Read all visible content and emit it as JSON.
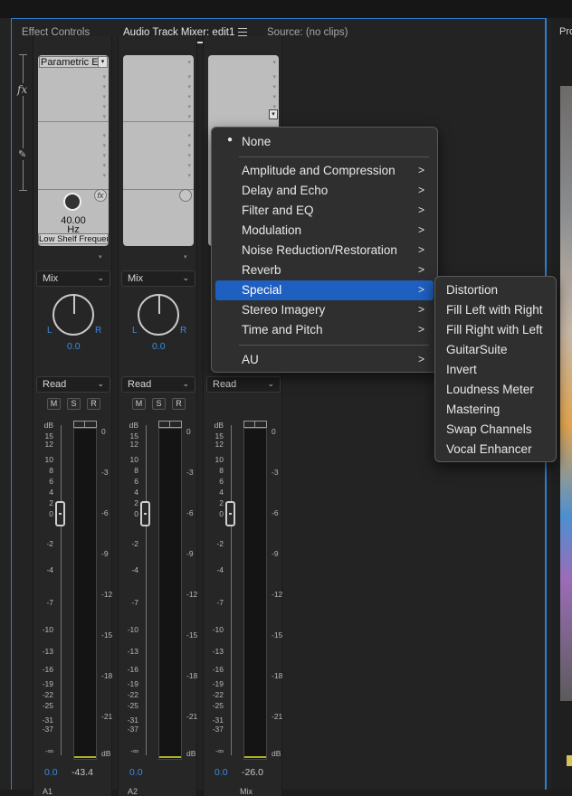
{
  "tabs": [
    {
      "label": "Effect Controls"
    },
    {
      "label": "Audio Track Mixer: edit1"
    },
    {
      "label": "Source: (no clips)"
    }
  ],
  "right_panel_tab": "Pro",
  "side_icons": [
    "fx-icon",
    "pen-icon"
  ],
  "channels": [
    {
      "effect_slot": "Parametric Eq",
      "param_value": "40.00",
      "param_unit": "Hz",
      "param_select": "Low Shelf Frequency",
      "mode": "Mix",
      "pan_value": "0.0",
      "automation": "Read",
      "msr": [
        "M",
        "S",
        "R"
      ],
      "fader_value": "0.0",
      "peak_value": "-43.4",
      "footer_label": "A1"
    },
    {
      "effect_slot": "",
      "mode": "Mix",
      "pan_value": "0.0",
      "automation": "Read",
      "msr": [
        "M",
        "S",
        "R"
      ],
      "fader_value": "0.0",
      "peak_value": "",
      "footer_label": "A2"
    },
    {
      "effect_slot": "",
      "automation": "Read",
      "fader_value": "0.0",
      "peak_value": "-26.0",
      "footer_label": "Mix"
    }
  ],
  "pan_labels": {
    "left": "L",
    "right": "R"
  },
  "fader_scale": [
    "dB",
    "15",
    "12",
    "10",
    "8",
    "6",
    "4",
    "2",
    "0",
    "-2",
    "-4",
    "-7",
    "-10",
    "-13",
    "-16",
    "-19",
    "-22",
    "-25",
    "-31",
    "-37",
    "-∞"
  ],
  "meter_scale": [
    "0",
    "-3",
    "-6",
    "-9",
    "-12",
    "-15",
    "-18",
    "-21",
    "dB"
  ],
  "context_menu": {
    "items": [
      {
        "label": "None",
        "bullet": true
      },
      {
        "label": "Amplitude and Compression",
        "submenu": true
      },
      {
        "label": "Delay and Echo",
        "submenu": true
      },
      {
        "label": "Filter and EQ",
        "submenu": true
      },
      {
        "label": "Modulation",
        "submenu": true
      },
      {
        "label": "Noise Reduction/Restoration",
        "submenu": true
      },
      {
        "label": "Reverb",
        "submenu": true
      },
      {
        "label": "Special",
        "submenu": true,
        "selected": true
      },
      {
        "label": "Stereo Imagery",
        "submenu": true
      },
      {
        "label": "Time and Pitch",
        "submenu": true
      },
      {
        "label": "AU",
        "submenu": true
      }
    ],
    "arrow_glyph": ">",
    "bullet_glyph": "●",
    "selected_color": "#1f5fc0"
  },
  "special_submenu": {
    "items": [
      "Distortion",
      "Fill Left with Right",
      "Fill Right with Left",
      "GuitarSuite",
      "Invert",
      "Loudness Meter",
      "Mastering",
      "Swap Channels",
      "Vocal Enhancer"
    ]
  },
  "colors": {
    "accent": "#2d7fd3",
    "value_blue": "#3a8be0",
    "panel_bg": "#232323"
  }
}
